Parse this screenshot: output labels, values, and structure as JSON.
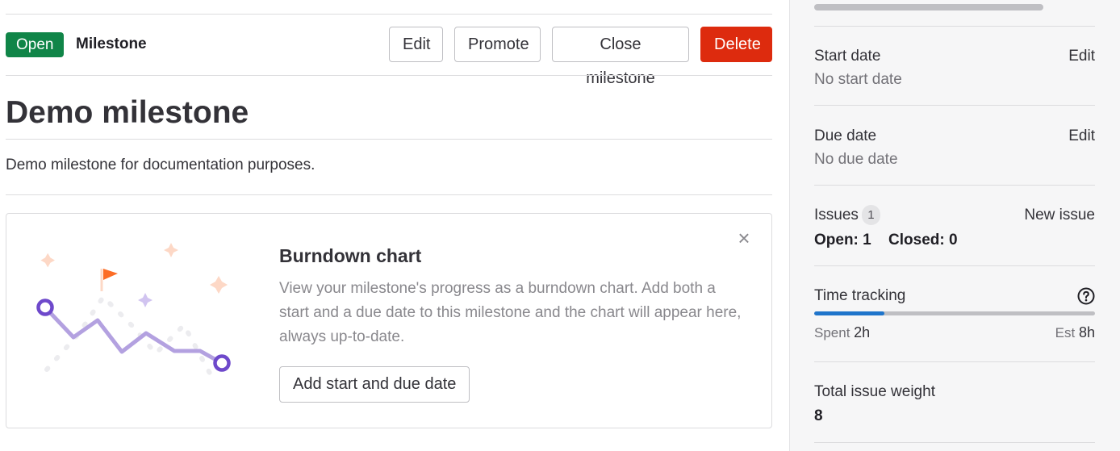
{
  "header": {
    "status_badge": "Open",
    "type_label": "Milestone",
    "buttons": {
      "edit": "Edit",
      "promote": "Promote",
      "close": "Close milestone",
      "delete": "Delete"
    }
  },
  "milestone": {
    "title": "Demo milestone",
    "description": "Demo milestone for documentation purposes."
  },
  "burndown_card": {
    "heading": "Burndown chart",
    "body": "View your milestone's progress as a burndown chart. Add both a start and a due date to this milestone and the chart will appear here, always up-to-date.",
    "close_glyph": "×",
    "action_label": "Add start and due date",
    "illustration_icon": "burndown-illustration"
  },
  "sidebar": {
    "start_date": {
      "label": "Start date",
      "value": "No start date",
      "action": "Edit"
    },
    "due_date": {
      "label": "Due date",
      "value": "No due date",
      "action": "Edit"
    },
    "issues": {
      "label": "Issues",
      "count": "1",
      "action": "New issue",
      "open": "Open: 1",
      "closed": "Closed: 0"
    },
    "time_tracking": {
      "label": "Time tracking",
      "help_icon": "question-circle-icon",
      "spent_label": "Spent",
      "spent_value": "2h",
      "est_label": "Est",
      "est_value": "8h",
      "progress": 0.25
    },
    "weight": {
      "label": "Total issue weight",
      "value": "8"
    }
  },
  "colors": {
    "open_badge": "#108548",
    "delete_button": "#dd2b0e",
    "progress_fill": "#1f75cb",
    "illustration_line": "#b3a1e0",
    "illustration_node": "#6e49cb",
    "flag": "#fc6d26"
  }
}
